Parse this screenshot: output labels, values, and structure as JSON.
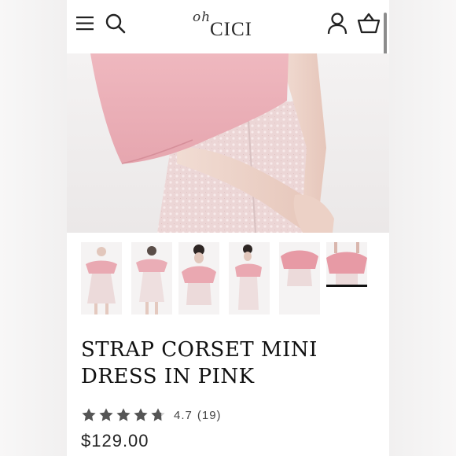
{
  "header": {
    "logo_small": "oh",
    "logo_main": "CICI",
    "icons": [
      "menu-icon",
      "search-icon",
      "account-icon",
      "cart-icon"
    ]
  },
  "gallery": {
    "thumbnail_count": 6,
    "active_index": 5
  },
  "product": {
    "title": "STRAP CORSET MINI DRESS IN PINK",
    "rating_value": "4.7",
    "review_count": "(19)",
    "stars_filled": 4.7,
    "price": "$129.00"
  },
  "colors": {
    "dress_pink": "#e8b6bd",
    "text": "#111111",
    "star": "#555555"
  }
}
